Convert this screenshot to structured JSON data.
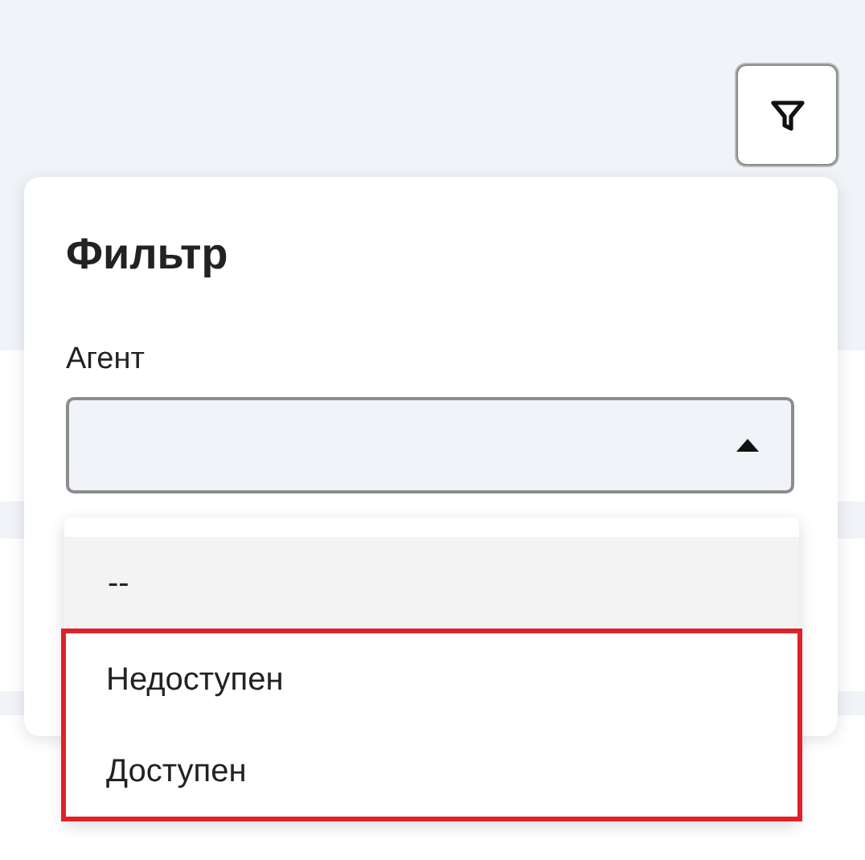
{
  "filter_button": {
    "expanded": true
  },
  "filter_panel": {
    "title": "Фильтр",
    "field": {
      "label": "Агент",
      "expanded": true
    }
  },
  "dropdown": {
    "options": [
      {
        "label": "--",
        "selected": true,
        "highlighted": false
      },
      {
        "label": "Недоступен",
        "selected": false,
        "highlighted": true
      },
      {
        "label": "Доступен",
        "selected": false,
        "highlighted": true
      }
    ]
  }
}
